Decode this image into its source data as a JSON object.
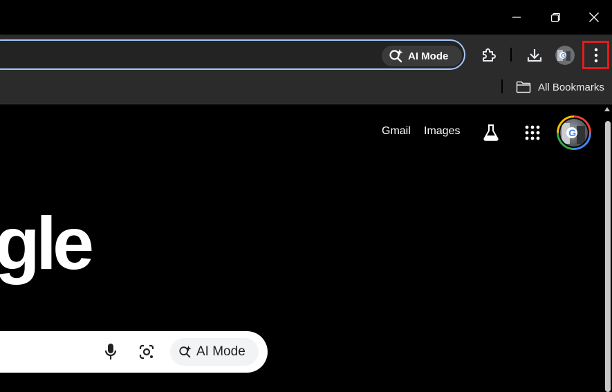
{
  "window": {
    "minimize_icon": "minimize-icon",
    "restore_icon": "restore-icon",
    "close_icon": "close-icon"
  },
  "toolbar": {
    "omnibox_ai_mode_label": "AI Mode",
    "extensions_icon": "puzzle-icon",
    "download_icon": "download-icon",
    "menu_icon": "kebab-menu-icon",
    "highlight_color": "#e21c1c",
    "omnibox_focus_color": "#a8c7fa"
  },
  "bookmarks_bar": {
    "all_bookmarks_label": "All Bookmarks",
    "folder_icon": "folder-icon"
  },
  "page": {
    "header_links": [
      "Gmail",
      "Images"
    ],
    "labs_icon": "flask-icon",
    "apps_icon": "apps-grid-icon",
    "logo_text": "gle",
    "search": {
      "mic_icon": "microphone-icon",
      "lens_icon": "lens-icon",
      "ai_mode_label": "AI Mode"
    }
  }
}
